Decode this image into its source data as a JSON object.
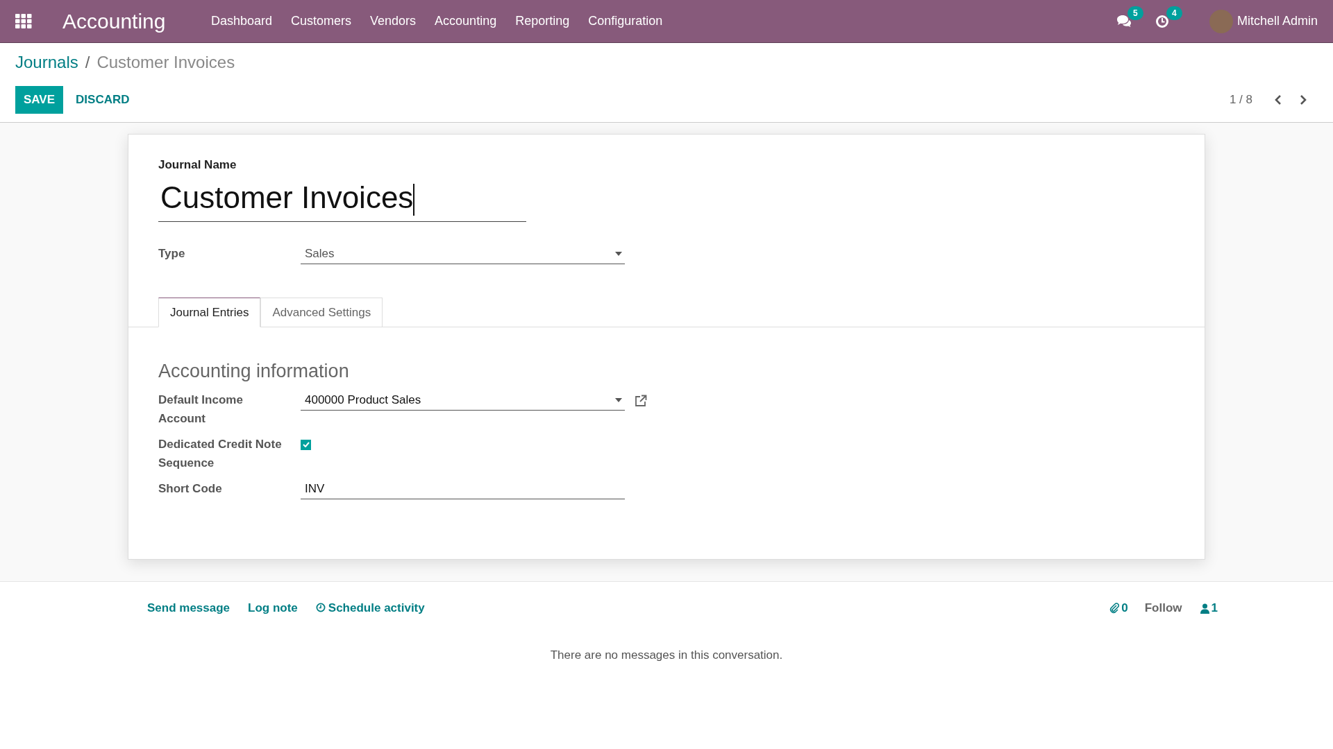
{
  "navbar": {
    "app_name": "Accounting",
    "menu": [
      "Dashboard",
      "Customers",
      "Vendors",
      "Accounting",
      "Reporting",
      "Configuration"
    ],
    "messages_count": "5",
    "activities_count": "4",
    "user_name": "Mitchell Admin"
  },
  "breadcrumbs": [
    {
      "label": "Journals",
      "current": false
    },
    {
      "label": "Customer Invoices",
      "current": true,
      "separator": "/"
    }
  ],
  "buttons": [
    {
      "label": "SAVE",
      "kind": "primary"
    },
    {
      "label": "DISCARD",
      "kind": "link"
    }
  ],
  "pager": "1 / 8",
  "form": {
    "name_label": "Journal Name",
    "name_value": "Customer Invoices",
    "fields": [
      {
        "label": "Type",
        "kind": "select",
        "value": "Sales"
      }
    ],
    "tabs": [
      {
        "label": "Journal Entries",
        "selected": true
      },
      {
        "label": "Advanced Settings",
        "selected": false
      }
    ],
    "section_title": "Accounting information",
    "section_fields": [
      {
        "label": "Default Income Account",
        "kind": "many2one",
        "value": "400000 Product Sales"
      },
      {
        "label": "Dedicated Credit Note Sequence",
        "kind": "checkbox",
        "checked": true
      },
      {
        "label": "Short Code",
        "kind": "text",
        "value": "INV"
      }
    ]
  },
  "chatter": {
    "actions": [
      {
        "label": "Send message",
        "kind": "plain"
      },
      {
        "label": "Log note",
        "kind": "plain"
      },
      {
        "label": "Schedule activity",
        "kind": "activity"
      }
    ],
    "attachments_count": "0",
    "follow_label": "Follow",
    "followers_count": "1",
    "empty_message": "There are no messages in this conversation."
  }
}
